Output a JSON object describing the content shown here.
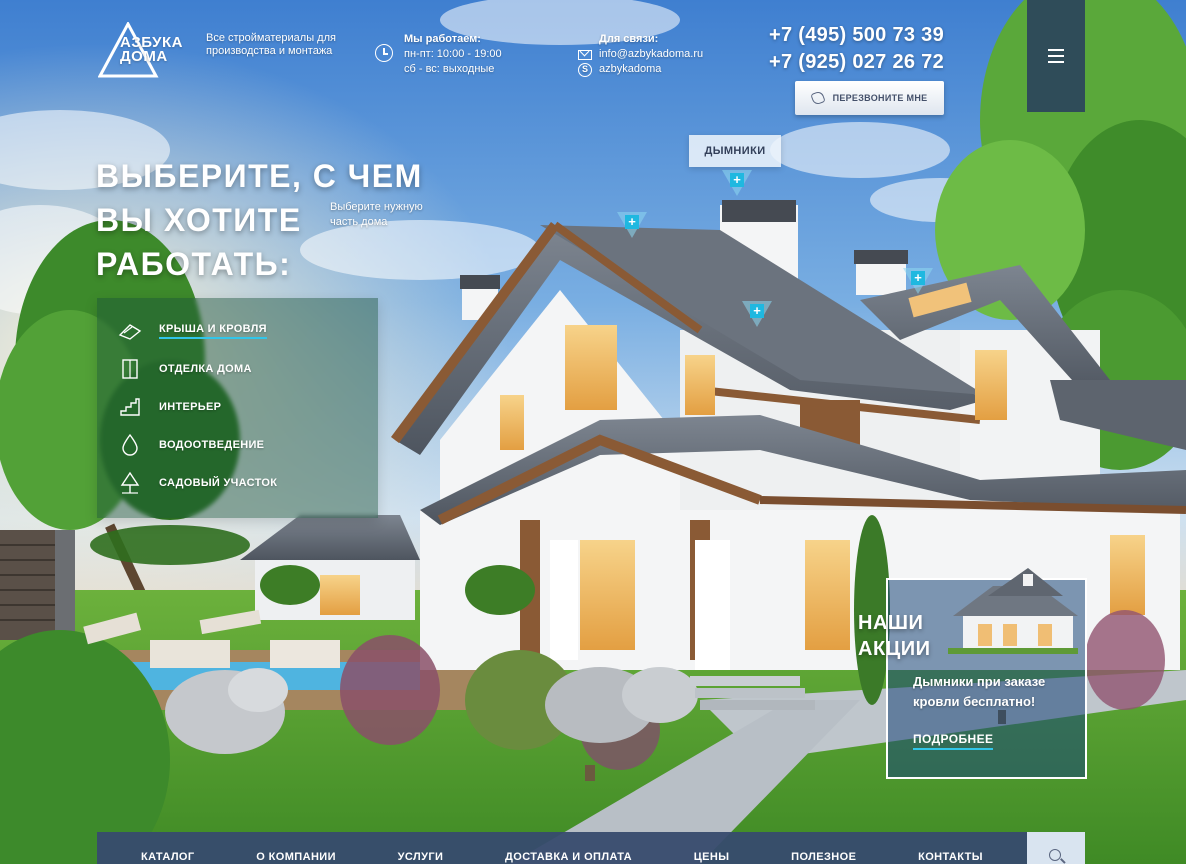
{
  "brand": {
    "name_line1": "АЗБУКА",
    "name_line2": "ДОМА",
    "tagline": "Все стройматериалы для производства и монтажа"
  },
  "work_hours": {
    "title": "Мы работаем:",
    "weekdays": "пн-пт: 10:00 - 19:00",
    "weekend": "сб - вс: выходные"
  },
  "contacts": {
    "title": "Для связи:",
    "email": "info@azbykadoma.ru",
    "skype": "azbykadoma"
  },
  "phones": [
    "+7 (495) 500 73 39",
    "+7 (925) 027 26 72"
  ],
  "callback_label": "ПЕРЕЗВОНИТЕ МНЕ",
  "hero": {
    "title_line1": "ВЫБЕРИТЕ, С ЧЕМ",
    "title_line2": "ВЫ ХОТИТЕ",
    "title_line3": "РАБОТАТЬ:",
    "hint": "Выберите нужную часть дома"
  },
  "categories": [
    {
      "label": "КРЫША И КРОВЛЯ",
      "icon": "roof-icon",
      "active": true
    },
    {
      "label": "ОТДЕЛКА ДОМА",
      "icon": "door-icon",
      "active": false
    },
    {
      "label": "ИНТЕРЬЕР",
      "icon": "stairs-icon",
      "active": false
    },
    {
      "label": "ВОДООТВЕДЕНИЕ",
      "icon": "drop-icon",
      "active": false
    },
    {
      "label": "САДОВЫЙ УЧАСТОК",
      "icon": "tree-icon",
      "active": false
    }
  ],
  "hotspot_label": "ДЫМНИКИ",
  "hotspot_symbol": "+",
  "promo": {
    "title_line1": "НАШИ",
    "title_line2": "АКЦИИ",
    "text": "Дымники при заказе кровли бесплатно!",
    "link": "ПОДРОБНЕЕ"
  },
  "nav": [
    "КАТАЛОГ",
    "О КОМПАНИИ",
    "УСЛУГИ",
    "ДОСТАВКА И ОПЛАТА",
    "ЦЕНЫ",
    "ПОЛЕЗНОЕ",
    "КОНТАКТЫ"
  ],
  "colors": {
    "accent": "#31c6ea",
    "navbar": "#374b6e",
    "sky": "#6a9bd4",
    "grass": "#4f9a2e"
  }
}
